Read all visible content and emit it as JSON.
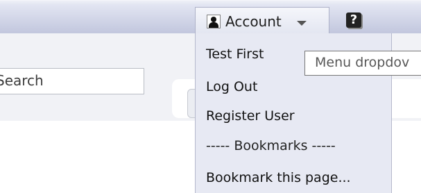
{
  "search": {
    "placeholder": "Search"
  },
  "account_menu": {
    "label": "Account",
    "items": [
      "Test First",
      "Log Out",
      "Register User",
      "----- Bookmarks -----",
      "Bookmark this page..."
    ]
  },
  "help": {
    "glyph": "?"
  },
  "tooltip": {
    "text": "Menu dropdov"
  },
  "icons": {
    "user": "user-icon",
    "caret": "chevron-down-icon",
    "help": "help-icon"
  }
}
